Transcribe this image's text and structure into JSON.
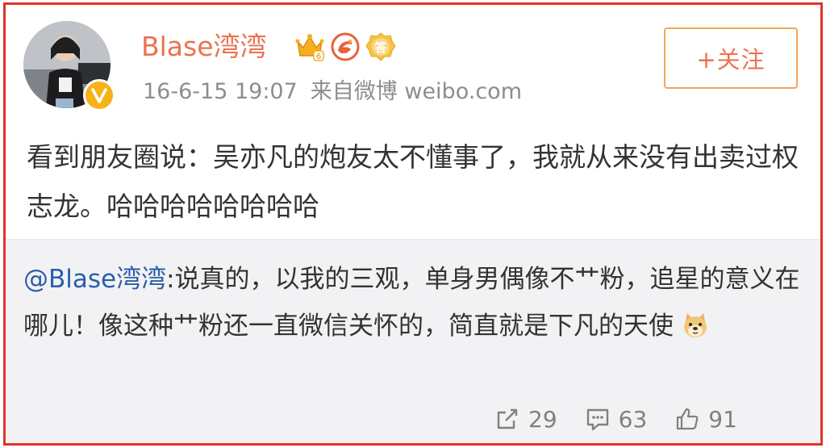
{
  "user": {
    "name": "Blase湾湾",
    "avatar": "avatar-photo",
    "verified_badge": "verified-v-icon",
    "badges": [
      "crown-vip-icon",
      "weibo-emblem-icon",
      "answer-badge-icon"
    ],
    "crown_level": "6",
    "answer_badge_text": "答"
  },
  "meta": {
    "time": "16-6-15 19:07",
    "source": "来自微博 weibo.com"
  },
  "follow_button": "+关注",
  "post": {
    "text": "看到朋友圈说：吴亦凡的炮友太不懂事了，我就从来没有出卖过权志龙。哈哈哈哈哈哈哈哈"
  },
  "repost": {
    "mention": "@Blase湾湾",
    "text": ":说真的，以我的三观，单身男偶像不艹粉，追星的意义在哪儿！像这种艹粉还一直微信关怀的，简直就是下凡的天使",
    "emoji": "doge-emoji-icon"
  },
  "actions": {
    "repost_count": "29",
    "comment_count": "63",
    "like_count": "91"
  },
  "colors": {
    "frame": "#e0342a",
    "username": "#eb7350",
    "mention": "#2a5ea8",
    "repost_bg": "#f2f2f5"
  }
}
